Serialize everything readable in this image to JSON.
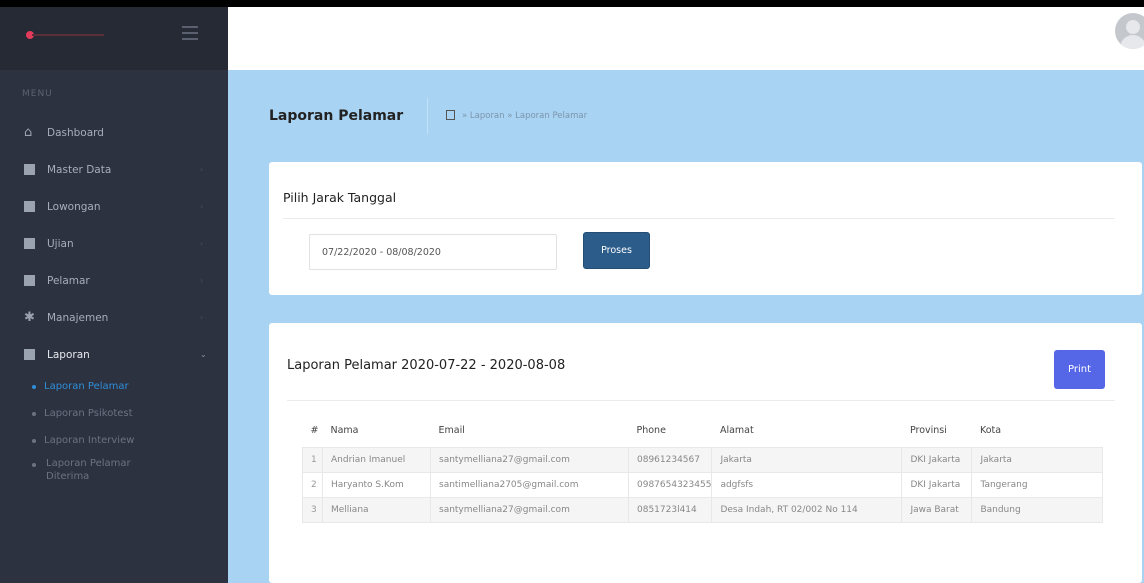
{
  "sidebar": {
    "menu_label": "MENU",
    "items": [
      {
        "label": "Dashboard",
        "icon": "home-icon"
      },
      {
        "label": "Master Data",
        "icon": "folder-icon"
      },
      {
        "label": "Lowongan",
        "icon": "briefcase-icon"
      },
      {
        "label": "Ujian",
        "icon": "list-icon"
      },
      {
        "label": "Pelamar",
        "icon": "user-icon"
      },
      {
        "label": "Manajemen",
        "icon": "gear-icon"
      },
      {
        "label": "Laporan",
        "icon": "folder-icon"
      }
    ],
    "sub_items": [
      {
        "label": "Laporan Pelamar",
        "active": true
      },
      {
        "label": "Laporan Psikotest"
      },
      {
        "label": "Laporan Interview"
      },
      {
        "label": "Laporan Pelamar Diterima"
      }
    ]
  },
  "breadcrumb": {
    "page_title": "Laporan Pelamar",
    "path": "» Laporan » Laporan Pelamar"
  },
  "filter_card": {
    "title": "Pilih Jarak Tanggal",
    "date_range_value": "07/22/2020 - 08/08/2020",
    "submit_label": "Proses"
  },
  "report_card": {
    "title": "Laporan Pelamar 2020-07-22 - 2020-08-08",
    "print_label": "Print",
    "columns": [
      "#",
      "Nama",
      "Email",
      "Phone",
      "Alamat",
      "Provinsi",
      "Kota"
    ],
    "rows": [
      [
        "1",
        "Andrian Imanuel",
        "santymelliana27@gmail.com",
        "08961234567",
        "Jakarta",
        "DKI Jakarta",
        "Jakarta"
      ],
      [
        "2",
        "Haryanto S.Kom",
        "santimelliana2705@gmail.com",
        "0987654323455",
        "adgfsfs",
        "DKI Jakarta",
        "Tangerang"
      ],
      [
        "3",
        "Melliana",
        "santymelliana27@gmail.com",
        "0851723l414",
        "Desa Indah, RT 02/002 No 114",
        "Jawa Barat",
        "Bandung"
      ]
    ]
  },
  "colors": {
    "sidebar_bg": "#2d3240",
    "page_bg": "#a8d3f2",
    "proses_button": "#2b5c8a",
    "print_button": "#5567e6",
    "active_link": "#2f8ed8"
  }
}
